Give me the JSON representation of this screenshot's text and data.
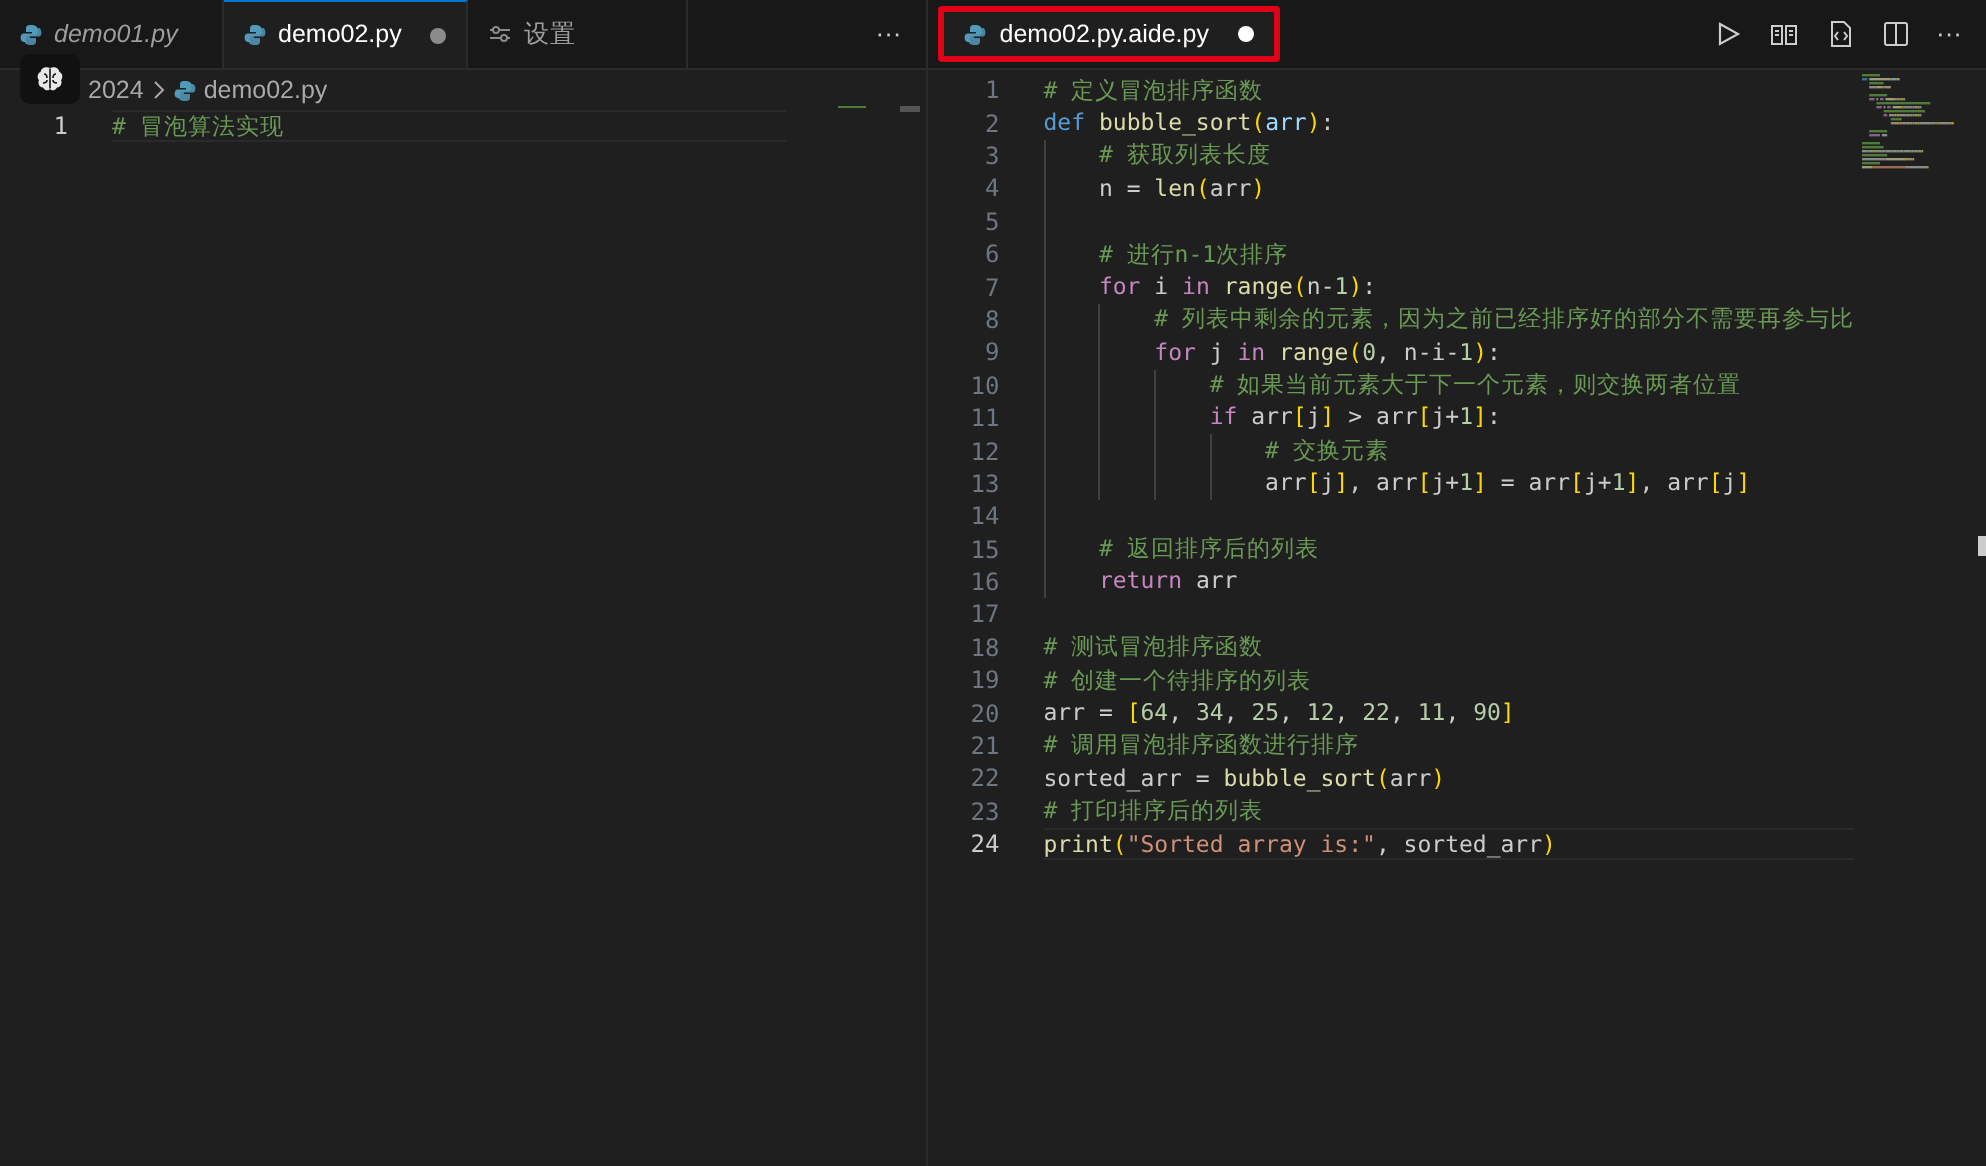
{
  "left_pane": {
    "tabs": [
      {
        "label": "demo01.py",
        "selected": false,
        "preview": true,
        "modified": false,
        "kind": "python"
      },
      {
        "label": "demo02.py",
        "selected": true,
        "preview": false,
        "modified": true,
        "kind": "python"
      },
      {
        "label": "设置",
        "selected": false,
        "preview": false,
        "modified": false,
        "kind": "settings"
      }
    ],
    "more": "···",
    "breadcrumb": [
      {
        "label": "2024",
        "kind": "folder"
      },
      {
        "label": "demo02.py",
        "kind": "python"
      }
    ],
    "lines": [
      {
        "number": "1",
        "current": true,
        "code": "# 冒泡算法实现"
      }
    ]
  },
  "right_pane": {
    "tab": {
      "label": "demo02.py.aide.py",
      "selected": true,
      "modified": true,
      "highlighted": true
    },
    "actions": [
      {
        "kind": "run"
      },
      {
        "kind": "preview"
      },
      {
        "kind": "diff"
      },
      {
        "kind": "split"
      },
      {
        "kind": "more",
        "label": "···"
      }
    ],
    "lines": [
      {
        "number": "1",
        "current": false,
        "code": "# 定义冒泡排序函数"
      },
      {
        "number": "2",
        "current": false,
        "code": "def bubble_sort(arr):"
      },
      {
        "number": "3",
        "current": false,
        "code": "    # 获取列表长度"
      },
      {
        "number": "4",
        "current": false,
        "code": "    n = len(arr)"
      },
      {
        "number": "5",
        "current": false
      },
      {
        "number": "6",
        "current": false,
        "code": "    # 进行n-1次排序"
      },
      {
        "number": "7",
        "current": false,
        "code": "    for i in range(n-1):"
      },
      {
        "number": "8",
        "current": false,
        "code": "        # 列表中剩余的元素，因为之前已经排序好的部分不需要再参与比"
      },
      {
        "number": "9",
        "current": false,
        "code": "        for j in range(0, n-i-1):"
      },
      {
        "number": "10",
        "current": false,
        "code": "            # 如果当前元素大于下一个元素，则交换两者位置"
      },
      {
        "number": "11",
        "current": false,
        "code": "            if arr[j] > arr[j+1]:"
      },
      {
        "number": "12",
        "current": false,
        "code": "                # 交换元素"
      },
      {
        "number": "13",
        "current": false,
        "code": "                arr[j], arr[j+1] = arr[j+1], arr[j]"
      },
      {
        "number": "14",
        "current": false
      },
      {
        "number": "15",
        "current": false,
        "code": "    # 返回排序后的列表"
      },
      {
        "number": "16",
        "current": false,
        "code": "    return arr"
      },
      {
        "number": "17",
        "current": false
      },
      {
        "number": "18",
        "current": false,
        "code": "# 测试冒泡排序函数"
      },
      {
        "number": "19",
        "current": false,
        "code": "# 创建一个待排序的列表"
      },
      {
        "number": "20",
        "current": false,
        "code": "arr = [64, 34, 25, 12, 22, 11, 90]"
      },
      {
        "number": "21",
        "current": false,
        "code": "# 调用冒泡排序函数进行排序"
      },
      {
        "number": "22",
        "current": false,
        "code": "sorted_arr = bubble_sort(arr)"
      },
      {
        "number": "23",
        "current": false,
        "code": "# 打印排序后的列表"
      },
      {
        "number": "24",
        "current": true,
        "code": "print(\"Sorted array is:\", sorted_arr)"
      }
    ]
  }
}
